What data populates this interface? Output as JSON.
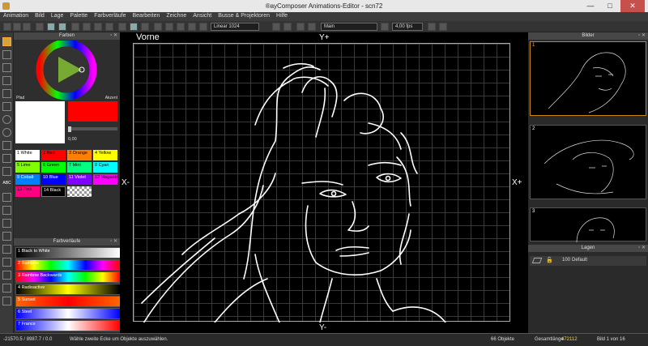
{
  "window": {
    "title": "®ayComposer Animations-Editor - scn72"
  },
  "menu": [
    "Animation",
    "Bild",
    "Lage",
    "Palette",
    "Farbverläufe",
    "Bearbeiten",
    "Zeichne",
    "Ansicht",
    "Busse & Projektoren",
    "Hilfe"
  ],
  "toolbar": {
    "curve_select": "Linear 1024",
    "layer_select": "Main",
    "fps": "4,00 fps"
  },
  "colors_panel": {
    "title": "Farben",
    "path_label": "Pfad",
    "accent_label": "Akzent",
    "slider_value": "0,00",
    "swatches": [
      {
        "label": "1 White",
        "color": "#ffffff"
      },
      {
        "label": "2 Red",
        "color": "#ff0000"
      },
      {
        "label": "3 Orange",
        "color": "#ff8000"
      },
      {
        "label": "4 Yellow",
        "color": "#ffff00"
      },
      {
        "label": "5 Lime",
        "color": "#80ff00"
      },
      {
        "label": "6 Green",
        "color": "#00ff00"
      },
      {
        "label": "7 Mint",
        "color": "#00ff80"
      },
      {
        "label": "8 Cyan",
        "color": "#00ffff"
      },
      {
        "label": "9 Cobalt",
        "color": "#0080ff"
      },
      {
        "label": "10 Blue",
        "color": "#0000ff"
      },
      {
        "label": "11 Violet",
        "color": "#8000ff"
      },
      {
        "label": "12 Magenta",
        "color": "#ff00ff"
      },
      {
        "label": "13 Pink",
        "color": "#ff0080"
      },
      {
        "label": "14 Black",
        "color": "#000000"
      }
    ]
  },
  "gradients_panel": {
    "title": "Farbverläufe",
    "items": [
      {
        "label": "1 Black to White",
        "css": "linear-gradient(to right,#000,#fff)"
      },
      {
        "label": "2 Rainbow",
        "css": "linear-gradient(to right,#f00,#ff0,#0f0,#0ff,#00f,#f0f,#f00)"
      },
      {
        "label": "3 Rainbow Backwards",
        "css": "linear-gradient(to right,#f00,#f0f,#00f,#0ff,#0f0,#ff0,#f00)"
      },
      {
        "label": "4 Radioactive",
        "css": "linear-gradient(to right,#000,#ff0,#000)"
      },
      {
        "label": "5 Sunset",
        "css": "linear-gradient(to right,#f60,#f00,#f60)"
      },
      {
        "label": "6 Steel",
        "css": "linear-gradient(to right,#00f,#fff,#00f)"
      },
      {
        "label": "7 France",
        "css": "linear-gradient(to right,#00f,#fff,#f00)"
      }
    ]
  },
  "canvas": {
    "view_label": "Vorne",
    "y_plus": "Y+",
    "y_minus": "Y-",
    "x_minus": "X-",
    "x_plus": "X+"
  },
  "frames_panel": {
    "title": "Bilder",
    "frames": [
      "1",
      "2",
      "3"
    ]
  },
  "layers_panel": {
    "title": "Lagen",
    "layer_number": "100",
    "layer_name": "Default"
  },
  "status": {
    "coords": "-21570.5 / 8987.7 / 0.0",
    "hint": "Wähle zweite Ecke um Objekte auszuwählen.",
    "objects": "66 Objekte",
    "total_length_label": "Gesamtlänge",
    "total_length": "472112",
    "frame_info": "Bild 1 von 16"
  }
}
